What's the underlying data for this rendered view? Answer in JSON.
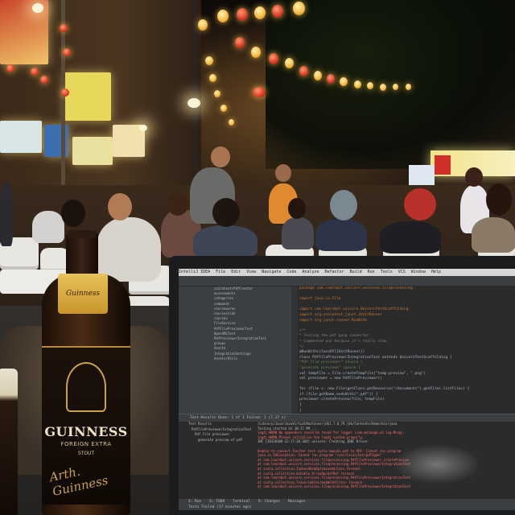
{
  "scene": {
    "bottle": {
      "brand": "GUINNESS",
      "variant": "FOREIGN EXTRA",
      "style": "STOUT",
      "neck_text": "Guinness",
      "signature": "Arth. Guinness"
    },
    "ide": {
      "app_name": "IntelliJ IDEA",
      "menu": [
        "IntelliJ IDEA",
        "File",
        "Edit",
        "View",
        "Navigate",
        "Code",
        "Analyze",
        "Refactor",
        "Build",
        "Run",
        "Tools",
        "VCS",
        "Window",
        "Help"
      ],
      "project_tree": [
        "scalatest/PdfCreator",
        "assessments",
        "categories",
        "commands",
        "coursewares",
        "courseslide",
        "courses",
        "FileService",
        "PdfFilePreviewerTest",
        "OpenXMLTest",
        "PdfPreviewerIntegrationTest",
        "groups",
        "health",
        "IntegrationSettings",
        "Assets/Utils"
      ],
      "code_lines": [
        {
          "cls": "kw",
          "text": "package com.learnbot.unicorn.services.fileprocessing"
        },
        {
          "cls": "",
          "text": ""
        },
        {
          "cls": "kw",
          "text": "import java.io.File"
        },
        {
          "cls": "",
          "text": ""
        },
        {
          "cls": "kw",
          "text": "import com.learnbot.unicorn.UnicornTestScaffolding"
        },
        {
          "cls": "kw",
          "text": "import org.scalatest.junit.JUnitRunner"
        },
        {
          "cls": "kw",
          "text": "import org.junit.runner.RunWith"
        },
        {
          "cls": "",
          "text": ""
        },
        {
          "cls": "cm",
          "text": "/**"
        },
        {
          "cls": "cm",
          "text": " * Testing the pdf-ppng converter"
        },
        {
          "cls": "cm",
          "text": " * Commented out because it's really slow."
        },
        {
          "cls": "cm",
          "text": " */"
        },
        {
          "cls": "",
          "text": "@RunWith(classOf[JUnitRunner])"
        },
        {
          "cls": "",
          "text": "class PdfFilePreviewerIntegrationTest extends UnicornTestScaffolding {"
        },
        {
          "cls": "str",
          "text": "  \"Pdf file previewer\" should {"
        },
        {
          "cls": "str",
          "text": "    \"generate previews\" ignore {"
        },
        {
          "cls": "",
          "text": "      val tempFile = File.createTempFile(\"temp-preview\", \".png\")"
        },
        {
          "cls": "",
          "text": "      val previewer = new PdfFilePreviewer()"
        },
        {
          "cls": "",
          "text": ""
        },
        {
          "cls": "",
          "text": "      for (file <- new File(getClass.getResource(\"/documents\").getFile).listFiles) {"
        },
        {
          "cls": "",
          "text": "        if (file.getName.endsWith(\".pdf\")) {"
        },
        {
          "cls": "",
          "text": "          previewer.createPreview(file, tempFile)"
        },
        {
          "cls": "",
          "text": "        }"
        },
        {
          "cls": "",
          "text": "      }"
        }
      ],
      "run_header": "Test Results  Done: 1 of 1  Failed: 1 (7.17 s)",
      "test_tree": [
        "Test Results",
        "PdfFilePreviewerIntegrationTest",
        "Pdf file previewer",
        "generate preview of pdf"
      ],
      "console_lines": [
        {
          "cls": "",
          "text": "/Library/Java/JavaVirtualMachines/jdk1.7.0_79.jdk/Contents/Home/bin/java"
        },
        {
          "cls": "",
          "text": "Testing started at 10:17 PM ..."
        },
        {
          "cls": "err",
          "text": "log4j:WARN No appenders could be found for logger (com.mchange.v2.log.MLog)."
        },
        {
          "cls": "err",
          "text": "log4j:WARN Please initialize the log4j system properly."
        },
        {
          "cls": "",
          "text": "INF [20150309-22:17:38.304] unicorn: Creating JDBC Driver"
        },
        {
          "cls": "",
          "text": ""
        },
        {
          "cls": "err",
          "text": "Unable to convert Iserter test suite manual.pdf to PDF: Cannot run program"
        },
        {
          "cls": "err",
          "text": "java.io.IOException: Cannot run program \"/usr/local/bin/pdf2ppm\""
        },
        {
          "cls": "err",
          "text": "  at com.learnbot.unicorn.services.fileprocessing.PdfFilePreviewer.createPreview"
        },
        {
          "cls": "err",
          "text": "  at com.learnbot.unicorn.services.fileprocessing.PdfFilePreviewerIntegrationTest"
        },
        {
          "cls": "err",
          "text": "  at scala.collection.IndexedSeqOptimized$class.foreach"
        },
        {
          "cls": "err",
          "text": "  at scala.collection.mutable.ArrayOps$ofRef.foreach"
        },
        {
          "cls": "err",
          "text": "  at com.learnbot.unicorn.services.fileprocessing.PdfFilePreviewerIntegrationTest"
        },
        {
          "cls": "err",
          "text": "  at scala.collection.TraversableLike$WithFilter.foreach"
        },
        {
          "cls": "err",
          "text": "  at com.learnbot.unicorn.services.fileprocessing.PdfFilePreviewerIntegrationTest"
        }
      ],
      "status_tabs": [
        "4: Run",
        "6: TODO",
        "Terminal",
        "9: Changes",
        "Messages"
      ],
      "status_text": "Tests Failed (17 minutes ago)"
    }
  }
}
